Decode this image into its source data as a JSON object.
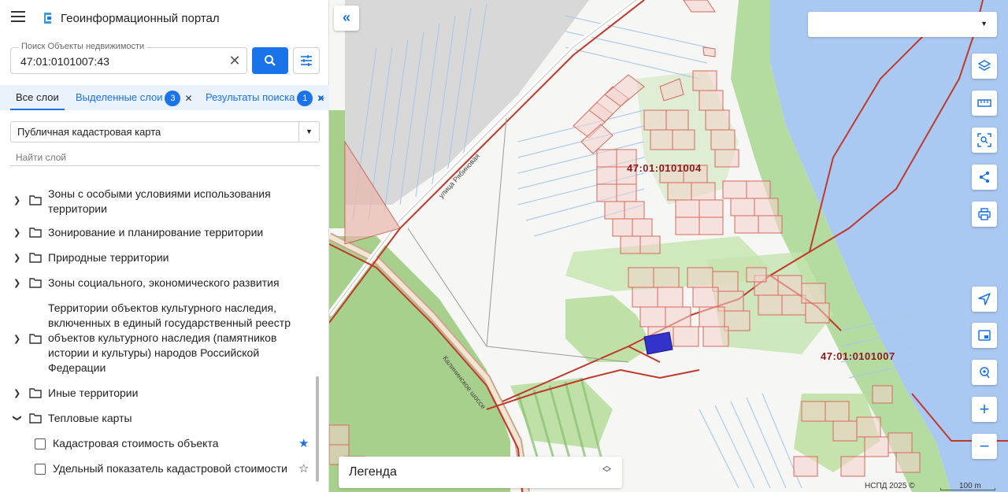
{
  "header": {
    "title": "Геоинформационный портал"
  },
  "search": {
    "label": "Поиск Объекты недвижимости",
    "value": "47:01:0101007:43"
  },
  "tabs": [
    {
      "label": "Все слои"
    },
    {
      "label": "Выделенные слои",
      "badge": "3"
    },
    {
      "label": "Результаты поиска",
      "badge": "1"
    }
  ],
  "layer_select": {
    "value": "Публичная кадастровая карта"
  },
  "find_layer": {
    "placeholder": "Найти слой"
  },
  "tree": {
    "items": [
      {
        "label": "Зоны с особыми условиями использования территории"
      },
      {
        "label": "Зонирование и планирование территории"
      },
      {
        "label": "Природные территории"
      },
      {
        "label": "Зоны социального, экономического развития"
      },
      {
        "label": "Территории объектов культурного наследия, включенных в единый государственный реестр объектов культурного наследия (памятников истории и культуры) народов Российской Федерации"
      },
      {
        "label": "Иные территории"
      },
      {
        "label": "Тепловые карты"
      }
    ],
    "checkboxes": [
      {
        "label": "Кадастровая стоимость объекта",
        "starred": true
      },
      {
        "label": "Удельный показатель кадастровой стоимости",
        "starred": false
      }
    ]
  },
  "map": {
    "labels": {
      "quarter_1": "47:01:0101004",
      "quarter_2": "47:01:0101007",
      "road_1": "Калининское шоссе",
      "road_2": "улица Рябиновая"
    },
    "legend": "Легенда",
    "attribution": "НСПД 2025 ©",
    "scale": "100 m"
  },
  "icons": {
    "menu": "menu-icon",
    "search": "search-icon",
    "filter": "filter-icon",
    "layers": "layers-icon",
    "ruler": "ruler-icon",
    "select_area": "select-area-icon",
    "share": "share-icon",
    "print": "print-icon",
    "locate": "navigation-icon",
    "minimap": "minimap-icon",
    "geolocate": "geolocate-icon",
    "zoom_in": "plus-icon",
    "zoom_out": "minus-icon"
  },
  "colors": {
    "accent": "#1a73e8",
    "selection": "#3333cc",
    "cadastral": "#c0392b",
    "water": "#aac9f2",
    "forest": "#a8d08d"
  }
}
